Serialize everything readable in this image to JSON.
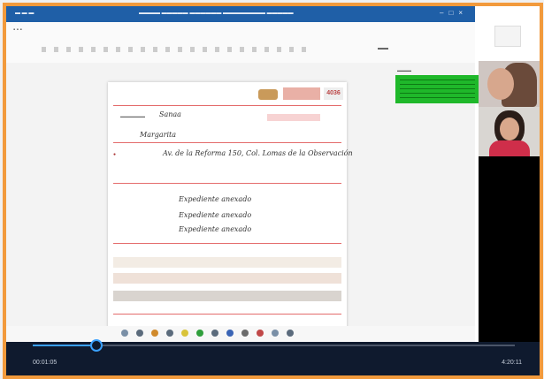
{
  "player": {
    "elapsed": "00:01:05",
    "remaining": "4:20:11",
    "progress": 0.13
  },
  "colors": {
    "frame_border": "#f29a3c",
    "title_bar": "#1f5fa7",
    "chat_highlight": "#1fb82a",
    "player_bg": "#0f1a2e",
    "seek_accent": "#3aa0ff"
  },
  "document": {
    "handwriting": {
      "field1": "Sanaa",
      "field2": "Margarita",
      "address": "Av. de la Reforma 150, Col. Lomas de la Observación",
      "row1": "Expediente anexado",
      "row2": "Expediente anexado",
      "row3": "Expediente anexado"
    },
    "logo_code": "4036"
  },
  "icons": [
    "pdf-tool-icon-1",
    "pdf-tool-icon-2",
    "pdf-tool-icon-3",
    "pdf-tool-icon-4",
    "pdf-tool-icon-5",
    "pdf-tool-icon-6",
    "pdf-tool-icon-7",
    "pdf-tool-icon-8",
    "pdf-tool-icon-9",
    "pdf-tool-icon-10",
    "pdf-tool-icon-11",
    "pdf-tool-icon-12"
  ]
}
